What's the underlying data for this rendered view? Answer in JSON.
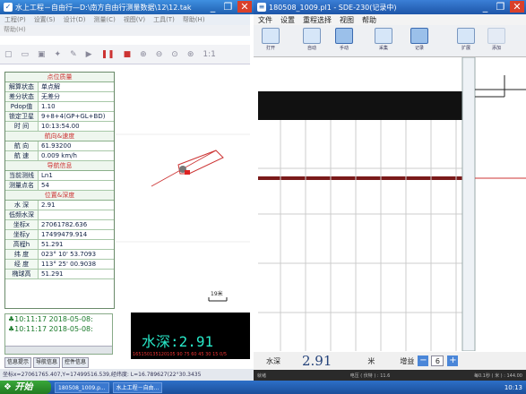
{
  "left_window": {
    "title": "水上工程－自由行—D:\\南方自由行测量数据\\12\\12.tak",
    "menu": [
      "工程(P)",
      "设置(S)",
      "设计(D)",
      "测量(C)",
      "视图(V)",
      "工具(T)",
      "帮助(H)"
    ],
    "path_hint": "帮助(H)",
    "info_panel": {
      "section_point_quality": "点位质量",
      "solution_label": "解算状态",
      "solution_value": "单点解",
      "diff_label": "差分状态",
      "diff_value": "无差分",
      "pdop_label": "Pdop值",
      "pdop_value": "1.10",
      "sats_label": "锁定卫星",
      "sats_value": "9+8+4(GP+GL+BD)",
      "time_label": "时 间",
      "time_value": "10:13:54.00",
      "section_heading_speed": "航向&速度",
      "heading_label": "航 向",
      "heading_value": "61.93200",
      "speed_label": "航 速",
      "speed_value": "0.009 km/h",
      "section_nav": "导航信息",
      "line_label": "当前测线",
      "line_value": "Ln1",
      "points_label": "测量点名",
      "points_value": "54",
      "section_pos_depth": "位置&深度",
      "depth_label": "水 深",
      "depth_value": "2.91",
      "low_label": "低频水深",
      "low_value": "",
      "x_label": "坐标x",
      "x_value": "27061782.636",
      "y_label": "坐标y",
      "y_value": "17499479.914",
      "h_label": "高程h",
      "h_value": "51.291",
      "lat_label": "纬 度",
      "lat_value": "023° 10' 53.7093",
      "lon_label": "经 度",
      "lon_value": "113° 25' 00.9038",
      "ellip_label": "椭球高",
      "ellip_value": "51.291"
    },
    "log_lines": [
      "10:11:17 2018-05-08:",
      "10:11:17 2018-05-08:"
    ],
    "tabs": [
      "信息提示",
      "导航信息",
      "控件信息"
    ],
    "depth_display": "水深:2.91",
    "depth_ticks": "165150135120105 90 75 60 45 30 15 0/5",
    "scale_label": "19米",
    "status": "坐标x=27061765.407,Y=17499516.539,经纬度: L=16.789627(22°30.3435"
  },
  "right_window": {
    "title": "180508_1009.pl1 - SDE-230(记录中)",
    "menu": [
      "文件",
      "设置",
      "重程选择",
      "视图",
      "帮助"
    ],
    "toolbar": [
      "打开",
      "自动",
      "手动",
      "采集",
      "记录",
      "扩展",
      "添加"
    ],
    "bottom": {
      "depth_label": "水深",
      "depth_value": "2.91",
      "unit": "米",
      "gain_label": "增益",
      "gain_value": "6"
    },
    "status_left": "就绪",
    "status_mid": "电压 ( 伏特 ) : 11.6",
    "status_right": "每0.1秒 ( 米 ) : 144.00"
  },
  "taskbar": {
    "start": "开始",
    "tasks": [
      "180508_1009.p...",
      "水上工程－自由..."
    ],
    "clock": "10:13"
  }
}
